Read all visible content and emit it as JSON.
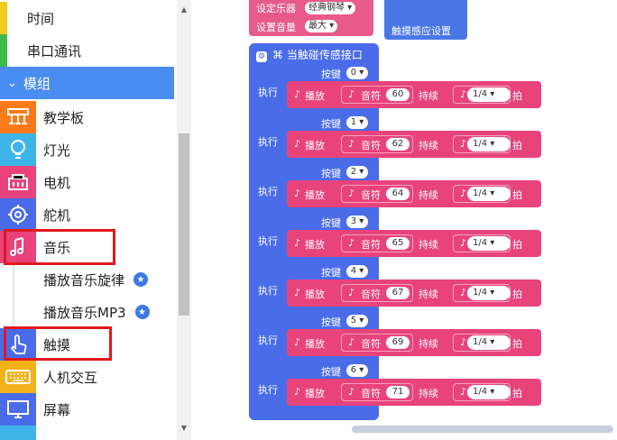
{
  "sidebar": {
    "top_items": [
      {
        "label": "时间",
        "stripe": "#f2cc21"
      },
      {
        "label": "串口通讯",
        "stripe": "#3dbb4a"
      }
    ],
    "group": {
      "label": "模组",
      "chevron": "chevron-down-icon"
    },
    "items": [
      {
        "label": "教学板",
        "icon": "circuit-board-icon",
        "color": "#ff7a1a"
      },
      {
        "label": "灯光",
        "icon": "lightbulb-icon",
        "color": "#3fb4e8"
      },
      {
        "label": "电机",
        "icon": "motor-icon",
        "color": "#e8437a"
      },
      {
        "label": "舵机",
        "icon": "servo-gear-icon",
        "color": "#4a6ce8"
      },
      {
        "label": "音乐",
        "icon": "music-note-icon",
        "color": "#e8437a"
      }
    ],
    "music_subitems": [
      {
        "label": "播放音乐旋律"
      },
      {
        "label": "播放音乐MP3"
      }
    ],
    "items2": [
      {
        "label": "触摸",
        "icon": "hand-pointer-icon",
        "color": "#4a6ce8"
      },
      {
        "label": "人机交互",
        "icon": "keyboard-icon",
        "color": "#f2b21a"
      },
      {
        "label": "屏幕",
        "icon": "monitor-icon",
        "color": "#4a6ce8"
      }
    ]
  },
  "blocks": {
    "instrument_label": "设定乐器",
    "instrument_value": "经典钢琴",
    "volume_label": "设置音量",
    "volume_value": "最大",
    "touch_settings": "触摸感应设置",
    "event_title": "当触碰传感接口",
    "key_label": "按键",
    "exec_label": "执行",
    "play_label": "播放",
    "note_label": "音符",
    "duration_label": "持续",
    "beat_label": "拍",
    "rows": [
      {
        "key": "0",
        "note": "60",
        "duration": "1/4"
      },
      {
        "key": "1",
        "note": "62",
        "duration": "1/4"
      },
      {
        "key": "2",
        "note": "64",
        "duration": "1/4"
      },
      {
        "key": "3",
        "note": "65",
        "duration": "1/4"
      },
      {
        "key": "4",
        "note": "67",
        "duration": "1/4"
      },
      {
        "key": "5",
        "note": "69",
        "duration": "1/4"
      },
      {
        "key": "6",
        "note": "71",
        "duration": "1/4"
      }
    ]
  },
  "colors": {
    "accent": "#4a8df0",
    "highlight": "#e0191e",
    "event_block": "#4a6ce8",
    "music_block": "#e8437a"
  }
}
